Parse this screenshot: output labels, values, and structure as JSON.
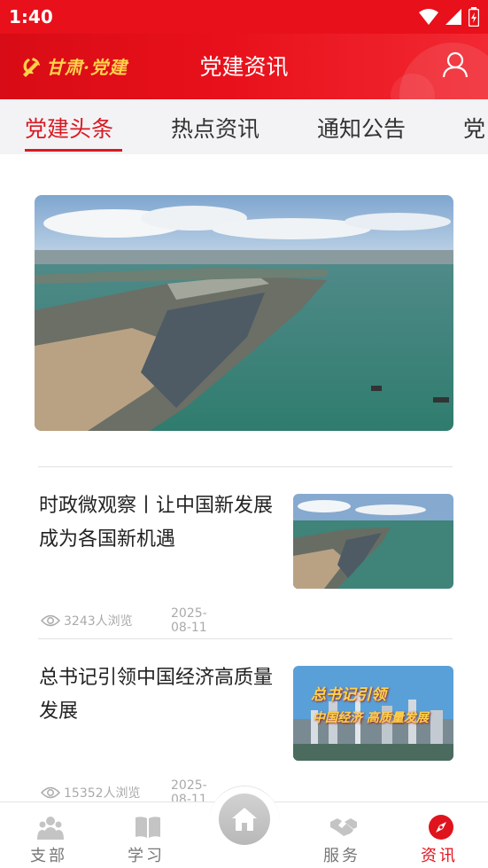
{
  "status_bar": {
    "time": "1:40"
  },
  "header": {
    "logo_text": "甘肃·党建",
    "title": "党建资讯"
  },
  "tabs": [
    {
      "label": "党建头条",
      "active": true
    },
    {
      "label": "热点资讯",
      "active": false
    },
    {
      "label": "通知公告",
      "active": false
    },
    {
      "label": "党",
      "active": false
    }
  ],
  "news": [
    {
      "title": "时政微观察丨让中国新发展成为各国新机遇",
      "views": "3243人浏览",
      "date": "2025-08-11"
    },
    {
      "title": "总书记引领中国经济高质量发展",
      "views": "15352人浏览",
      "date": "2025-08-11",
      "thumb_text_1": "总书记引领",
      "thumb_text_2": "中国经济 高质量发展"
    }
  ],
  "bottom_nav": [
    {
      "label": "支部",
      "icon": "group-icon"
    },
    {
      "label": "学习",
      "icon": "book-icon"
    },
    {
      "label": "",
      "icon": "home-icon"
    },
    {
      "label": "服务",
      "icon": "handshake-icon"
    },
    {
      "label": "资讯",
      "icon": "compass-icon",
      "active": true
    }
  ],
  "colors": {
    "brand_red": "#e8101a",
    "tab_active": "#d81a22",
    "gold": "#ffd24a"
  }
}
